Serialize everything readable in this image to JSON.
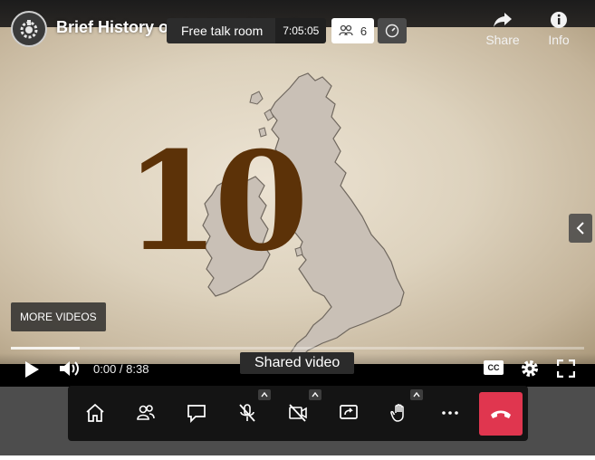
{
  "video": {
    "title": "Brief History of the Royal Family",
    "big_number": "10",
    "more_videos_label": "MORE VIDEOS",
    "share_label": "Share",
    "info_label": "Info",
    "time_display": "0:00 / 8:38",
    "cc_label": "CC",
    "progress_buffered": 0.12
  },
  "meeting": {
    "room_name": "Free talk room",
    "elapsed_time": "7:05:05",
    "participant_count": "6",
    "shared_video_label": "Shared video"
  },
  "toolbar": {
    "buttons": [
      "home-icon",
      "participants-icon",
      "chat-icon",
      "microphone-muted-icon",
      "camera-off-icon",
      "share-screen-icon",
      "raise-hand-icon",
      "more-icon",
      "hangup-icon"
    ]
  },
  "colors": {
    "hangup": "#e0364f",
    "number": "#5c3208",
    "toolbar_bg": "#141414",
    "backdrop": "#4d4d4d"
  }
}
